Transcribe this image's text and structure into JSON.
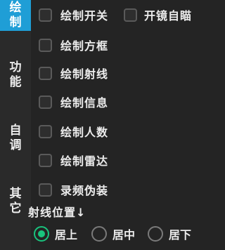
{
  "sidebar": {
    "tabs": [
      {
        "label": [
          "绘",
          "制"
        ],
        "active": true
      },
      {
        "label": [
          "功",
          "能"
        ],
        "active": false
      },
      {
        "label": [
          "自",
          "调"
        ],
        "active": false
      },
      {
        "label": [
          "其",
          "它"
        ],
        "active": false
      }
    ]
  },
  "options": [
    {
      "label": "绘制开关",
      "checked": false
    },
    {
      "label": "开镜自瞄",
      "checked": false
    },
    {
      "label": "绘制方框",
      "checked": false
    },
    {
      "label": "绘制射线",
      "checked": false
    },
    {
      "label": "绘制信息",
      "checked": false
    },
    {
      "label": "绘制人数",
      "checked": false
    },
    {
      "label": "绘制雷达",
      "checked": false
    },
    {
      "label": "录频伪装",
      "checked": false
    }
  ],
  "ray_position": {
    "label": "射线位置↓",
    "choices": [
      {
        "label": "居上",
        "selected": true
      },
      {
        "label": "居中",
        "selected": false
      },
      {
        "label": "居下",
        "selected": false
      }
    ]
  },
  "colors": {
    "accent": "#1f9ed6",
    "radio_on": "#19c37d",
    "background": "#242424"
  }
}
